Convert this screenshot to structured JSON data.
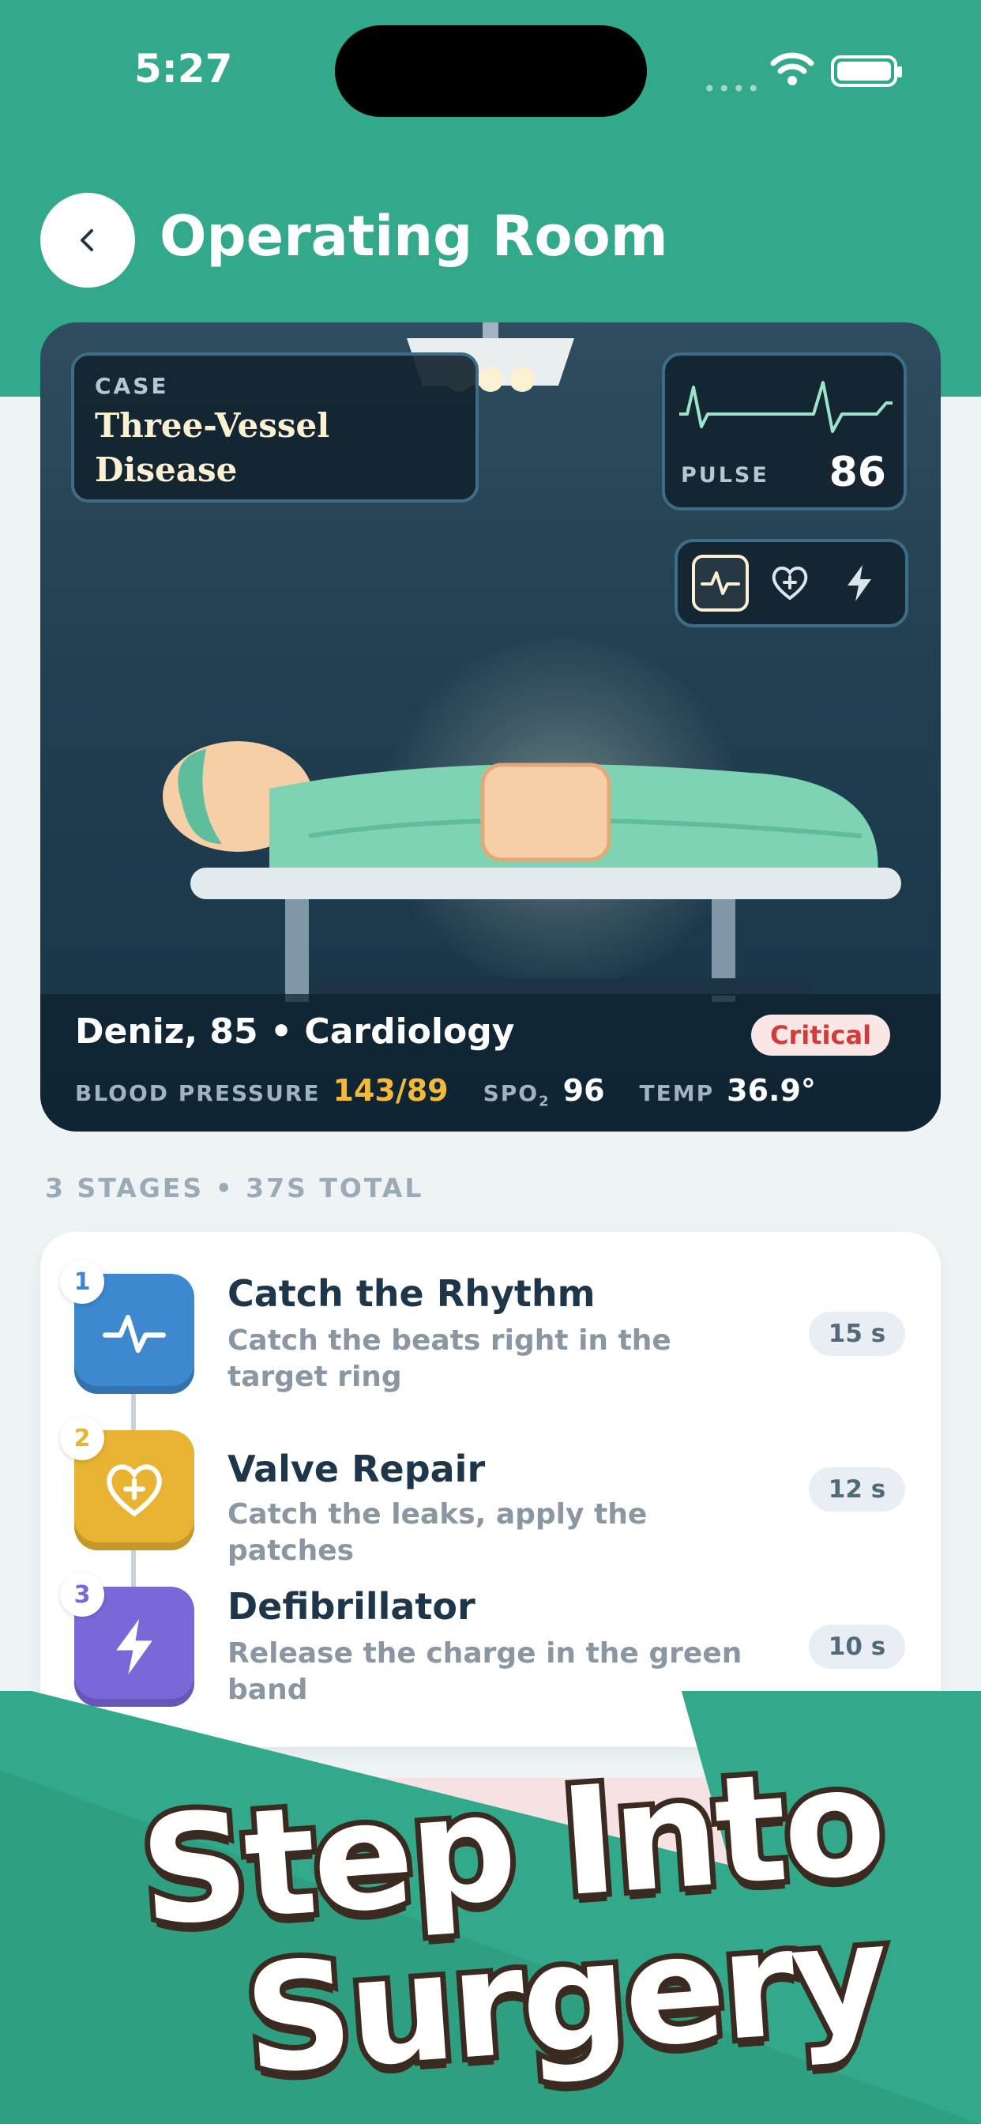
{
  "status_bar": {
    "time": "5:27"
  },
  "header": {
    "title": "Operating Room"
  },
  "case": {
    "label": "CASE",
    "name_line1": "Three-Vessel",
    "name_line2": "Disease"
  },
  "pulse": {
    "label": "PULSE",
    "value": "86"
  },
  "icon_tray": [
    "heartbeat-icon",
    "heart-plus-icon",
    "bolt-icon"
  ],
  "patient": {
    "summary": "Deniz, 85 • Cardiology",
    "status": "Critical",
    "status_color": "#d33b3b",
    "vitals": {
      "bp_label": "BLOOD PRESSURE",
      "bp_value": "143/89",
      "spo2_label": "SPO",
      "spo2_sub": "2",
      "spo2_value": "96",
      "temp_label": "TEMP",
      "temp_value": "36.9°"
    }
  },
  "stages_header": "3 STAGES • 37S TOTAL",
  "stages": [
    {
      "num": "1",
      "title": "Catch the Rhythm",
      "desc": "Catch the beats right in the target ring",
      "duration": "15 s",
      "color": "#3d88cf",
      "icon": "heartbeat-icon"
    },
    {
      "num": "2",
      "title": "Valve Repair",
      "desc": "Catch the leaks, apply the patches",
      "duration": "12 s",
      "color": "#e8b332",
      "icon": "heart-plus-icon"
    },
    {
      "num": "3",
      "title": "Defibrillator",
      "desc": "Release the charge in the green band",
      "duration": "10 s",
      "color": "#7a68d9",
      "icon": "bolt-icon"
    }
  ],
  "promo": {
    "line1": "Step Into",
    "line2": "Surgery"
  },
  "colors": {
    "brand": "#32a98a",
    "room_bg": "#223f52"
  }
}
